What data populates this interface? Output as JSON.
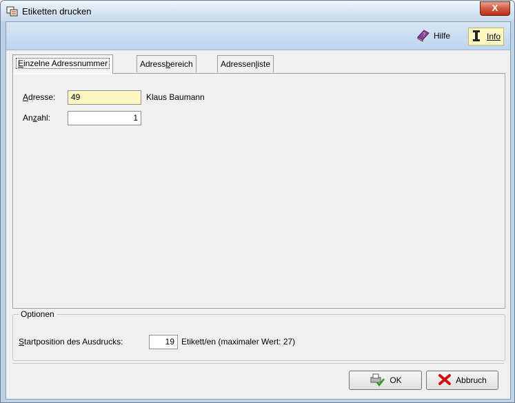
{
  "window": {
    "title": "Etiketten drucken",
    "close_label": "X"
  },
  "toolbar": {
    "hilfe_label": "Hilfe",
    "info_label": "Info"
  },
  "tabs": [
    {
      "label_u": "E",
      "label_rest": "inzelne Adressnummer",
      "active": true
    },
    {
      "label_pre": "Adress",
      "label_u": "b",
      "label_rest": "ereich",
      "active": false
    },
    {
      "label_pre": "Adressen",
      "label_u": "l",
      "label_rest": "iste",
      "active": false
    }
  ],
  "form": {
    "adresse": {
      "label_u": "A",
      "label_rest": "dresse:",
      "value": "49",
      "name_display": "Klaus Baumann"
    },
    "anzahl": {
      "label_pre": "An",
      "label_u": "z",
      "label_rest": "ahl:",
      "value": "1"
    }
  },
  "options": {
    "title": "Optionen",
    "startpos": {
      "label_u": "S",
      "label_rest": "tartposition des Ausdrucks:",
      "value": "19",
      "suffix": "Etikett/en (maximaler Wert: 27)"
    }
  },
  "buttons": {
    "ok_label": "OK",
    "abbruch_label": "Abbruch"
  }
}
